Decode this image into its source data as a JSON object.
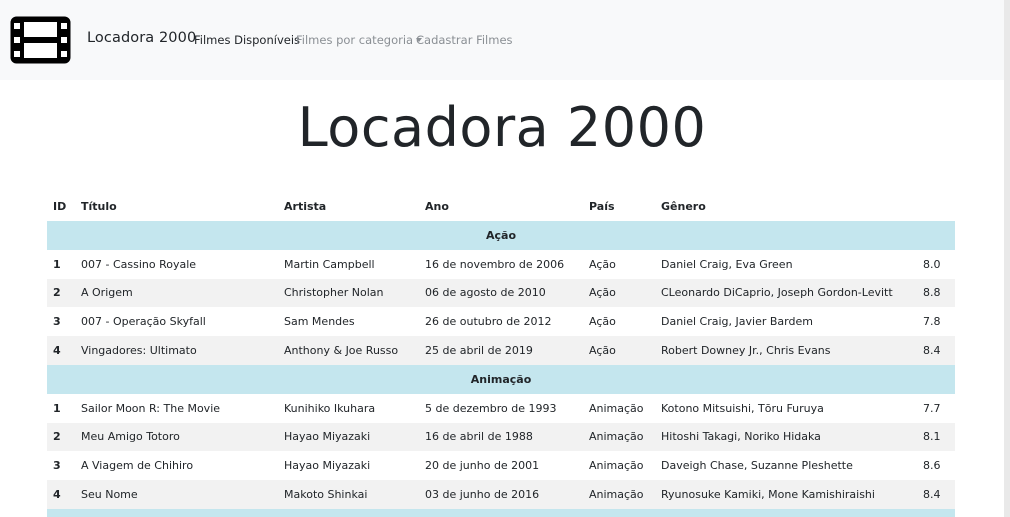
{
  "navbar": {
    "logo_icon": "film-icon",
    "brand": "Locadora 2000",
    "links": [
      {
        "label": "Filmes Disponíveis",
        "active": true
      },
      {
        "label": "Filmes por categoria",
        "dropdown": true
      },
      {
        "label": "Cadastrar Filmes"
      }
    ]
  },
  "page": {
    "title": "Locadora 2000"
  },
  "table": {
    "headers": [
      "ID",
      "Título",
      "Artista",
      "Ano",
      "País",
      "Gênero",
      ""
    ],
    "categories": [
      {
        "name": "Ação",
        "rows": [
          {
            "id": "1",
            "titulo": "007 - Cassino Royale",
            "artista": "Martin Campbell",
            "ano": "16 de novembro de 2006",
            "pais": "Ação",
            "genero": "Daniel Craig, Eva Green",
            "nota": "8.0"
          },
          {
            "id": "2",
            "titulo": "A Origem",
            "artista": "Christopher Nolan",
            "ano": "06 de agosto de 2010",
            "pais": "Ação",
            "genero": "CLeonardo DiCaprio, Joseph Gordon-Levitt",
            "nota": "8.8"
          },
          {
            "id": "3",
            "titulo": "007 - Operação Skyfall",
            "artista": "Sam Mendes",
            "ano": "26 de outubro de 2012",
            "pais": "Ação",
            "genero": "Daniel Craig, Javier Bardem",
            "nota": "7.8"
          },
          {
            "id": "4",
            "titulo": "Vingadores: Ultimato",
            "artista": "Anthony & Joe Russo",
            "ano": "25 de abril de 2019",
            "pais": "Ação",
            "genero": "Robert Downey Jr., Chris Evans",
            "nota": "8.4"
          }
        ]
      },
      {
        "name": "Animação",
        "rows": [
          {
            "id": "1",
            "titulo": "Sailor Moon R: The Movie",
            "artista": "Kunihiko Ikuhara",
            "ano": "5 de dezembro de 1993",
            "pais": "Animação",
            "genero": "Kotono Mitsuishi, Tōru Furuya",
            "nota": "7.7"
          },
          {
            "id": "2",
            "titulo": "Meu Amigo Totoro",
            "artista": "Hayao Miyazaki",
            "ano": "16 de abril de 1988",
            "pais": "Animação",
            "genero": "Hitoshi Takagi, Noriko Hidaka",
            "nota": "8.1"
          },
          {
            "id": "3",
            "titulo": "A Viagem de Chihiro",
            "artista": "Hayao Miyazaki",
            "ano": "20 de junho de 2001",
            "pais": "Animação",
            "genero": "Daveigh Chase, Suzanne Pleshette",
            "nota": "8.6"
          },
          {
            "id": "4",
            "titulo": "Seu Nome",
            "artista": "Makoto Shinkai",
            "ano": "03 de junho de 2016",
            "pais": "Animação",
            "genero": "Ryunosuke Kamiki, Mone Kamishiraishi",
            "nota": "8.4"
          }
        ]
      }
    ],
    "colors": {
      "category_bg": "#c4e6ee",
      "stripe_bg": "#f2f2f2",
      "navbar_bg": "#f8f9fa"
    }
  }
}
